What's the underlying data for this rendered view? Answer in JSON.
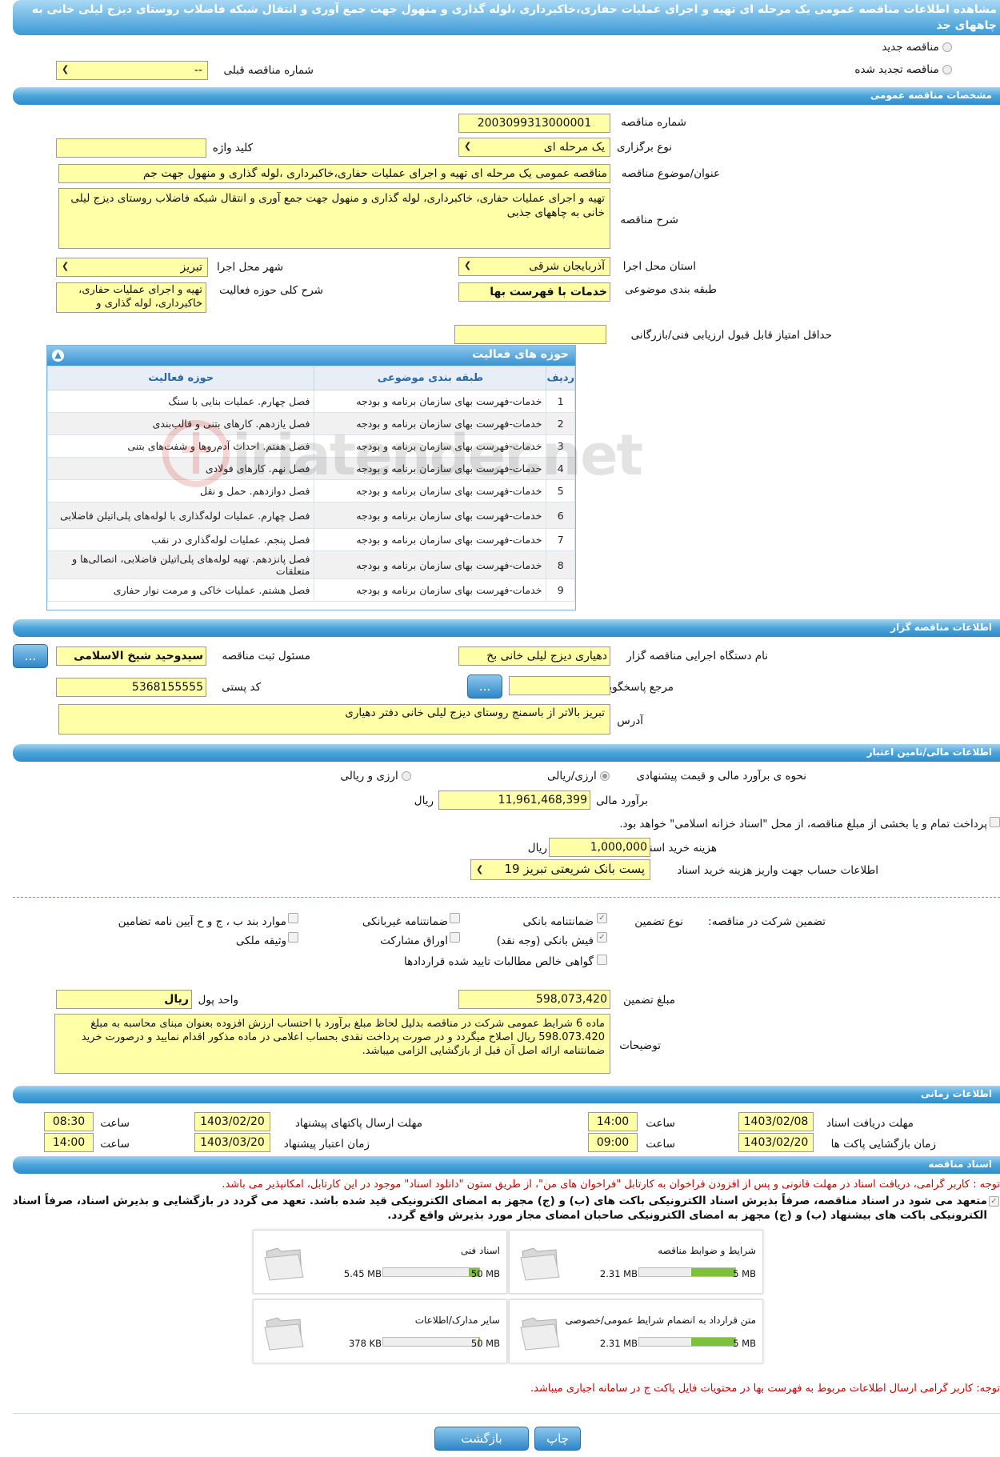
{
  "page_title": "مشاهده اطلاعات مناقصه عمومی یک مرحله ای تهیه و اجرای عملیات حفاری،خاکبرداری ،لوله گذاری و منهول جهت جمع آوری و انتقال شبکه فاضلاب روستای دیزج لیلی خانی به چاههای جذ",
  "top": {
    "new_tender": "مناقصه جدید",
    "renewed_tender": "مناقصه تجدید شده",
    "prev_tender_label": "شماره مناقصه قبلی",
    "prev_tender_value": "--"
  },
  "sections": {
    "general": "مشخصات مناقصه عمومی",
    "organizer": "اطلاعات مناقصه گزار",
    "financial": "اطلاعات مالی/تامین اعتبار",
    "timing": "اطلاعات زمانی",
    "documents": "اسناد مناقصه"
  },
  "general": {
    "tender_number_label": "شماره مناقصه",
    "tender_number": "2003099313000001",
    "holding_type_label": "نوع برگزاری",
    "holding_type": "یک مرحله ای",
    "keyword_label": "کلید واژه",
    "keyword": "",
    "subject_label": "عنوان/موضوع مناقصه",
    "subject": "مناقصه عمومی یک مرحله ای تهیه و  اجرای عملیات حفاری،خاکبرداری ،لوله گذاری و منهول جهت جم",
    "description_label": "شرح مناقصه",
    "description": "تهیه و  اجرای عملیات حفاری، خاکبرداری، لوله گذاری و منهول جهت جمع آوری و انتقال شبکه فاضلاب روستای دیزج لیلی خانی به چاههای جذبی",
    "province_label": "استان محل اجرا",
    "province": "آذربایجان شرقی",
    "city_label": "شهر محل اجرا",
    "city": "تبریز",
    "category_label": "طبقه بندی موضوعی",
    "category": "خدمات با فهرست بها",
    "activity_desc_label": "شرح کلی حوزه فعالیت",
    "activity_desc": "تهیه و  اجرای عملیات حفاری، خاکبرداری، لوله گذاری و",
    "min_score_label": "حداقل امتیاز قابل قبول ارزیابی فنی/بازرگانی",
    "min_score": ""
  },
  "activity_table": {
    "title": "حوزه های فعالیت",
    "columns": [
      "ردیف",
      "طبقه بندی موضوعی",
      "حوزه فعالیت"
    ],
    "rows": [
      [
        "1",
        "خدمات-فهرست بهای سازمان برنامه و بودجه",
        "فصل چهارم. عملیات بنایی با سنگ"
      ],
      [
        "2",
        "خدمات-فهرست بهای سازمان برنامه و بودجه",
        "فصل یازدهم. کارهای بتنی و قالب‌بندی"
      ],
      [
        "3",
        "خدمات-فهرست بهای سازمان برنامه و بودجه",
        "فصل هفتم. احداث آدم‌روها و شفت‌های بتنی"
      ],
      [
        "4",
        "خدمات-فهرست بهای سازمان برنامه و بودجه",
        "فصل نهم. کارهای فولادی"
      ],
      [
        "5",
        "خدمات-فهرست بهای سازمان برنامه و بودجه",
        "فصل دوازدهم. حمل و نقل"
      ],
      [
        "6",
        "خدمات-فهرست بهای سازمان برنامه و بودجه",
        "فصل چهارم. عملیات لوله‌گذاری با لوله‌های پلی‌اتیلن فاضلابی"
      ],
      [
        "7",
        "خدمات-فهرست بهای سازمان برنامه و بودجه",
        "فصل پنجم. عملیات لوله‌گذاری در نقب"
      ],
      [
        "8",
        "خدمات-فهرست بهای سازمان برنامه و بودجه",
        "فصل پانزدهم. تهیه لوله‌های پلی‌اتیلن فاضلابی، اتصالی‌ها و متعلقات"
      ],
      [
        "9",
        "خدمات-فهرست بهای سازمان برنامه و بودجه",
        "فصل هشتم. عملیات خاکی و مرمت نوار حفاری"
      ]
    ]
  },
  "watermark": "iriatender.net",
  "organizer": {
    "org_name_label": "نام دستگاه اجرایی مناقصه گزار",
    "org_name": "دهیاری دیزج لیلی خانی بخ",
    "registrar_label": "مسئول ثبت مناقصه",
    "registrar": "سیدوحید شیخ الاسلامی",
    "more_button": "...",
    "reference_label": "مرجع پاسخگویی",
    "reference": "",
    "postal_label": "کد پستی",
    "postal": "5368155555",
    "address_label": "آدرس",
    "address": "تبریز بالاتر از باسمنج روستای دیزج لیلی خانی دفتر دهیاری"
  },
  "financial": {
    "estimate_type_label": "نحوه ی برآورد مالی و قیمت پیشنهادی",
    "opt_rial": "ارزی/ریالی",
    "opt_fx": "ارزی و ریالی",
    "estimate_label": "برآورد مالی",
    "estimate": "11,961,468,399",
    "rial": "ریال",
    "treasury_note": "پرداخت تمام و یا بخشی از مبلغ مناقصه، از محل \"اسناد خزانه اسلامی\" خواهد بود.",
    "doc_fee_label": "هزینه خرید اسناد",
    "doc_fee": "1,000,000",
    "account_label": "اطلاعات حساب جهت واریز هزینه خرید اسناد",
    "account": "پست بانک شریعتی تبریز 19",
    "guarantee_label": "تضمین شرکت در مناقصه:",
    "guarantee_type_label": "نوع تضمین",
    "g_bank": "ضمانتنامه بانکی",
    "g_nonbank": "ضمانتنامه غیربانکی",
    "g_clauses": "موارد بند ب ، ج و ح آیین نامه تضامین",
    "g_check": "فیش بانکی (وجه نقد)",
    "g_bonds": "اوراق مشارکت",
    "g_property": "وثیقه ملکی",
    "g_receivable": "گواهی خالص مطالبات تایید شده قراردادها",
    "amount_label": "مبلغ تضمین",
    "amount": "598,073,420",
    "currency_label": "واحد پول",
    "currency": "ریال",
    "notes_label": "توضیحات",
    "notes": "ماده 6 شرایط عمومی شرکت در مناقصه بدلیل لحاظ مبلغ برآورد با احتساب ارزش افزوده بعنوان مبنای محاسبه به مبلغ 598.073.420 ریال اصلاح میگردد و در صورت پرداخت نقدی بحساب اعلامی در ماده مذکور اقدام نمایید و درصورت خرید ضمانتنامه ارائه اصل آن قبل از بازگشایی الزامی میباشد."
  },
  "timing": {
    "receive_deadline_label": "مهلت دریافت اسناد",
    "receive_deadline": "1403/02/08",
    "time_label": "ساعت",
    "receive_time": "14:00",
    "send_deadline_label": "مهلت ارسال پاکتهای پیشنهاد",
    "send_deadline": "1403/02/20",
    "send_time": "08:30",
    "opening_label": "زمان بازگشایی پاکت ها",
    "opening": "1403/02/20",
    "opening_time": "09:00",
    "validity_label": "زمان اعتبار پیشنهاد",
    "validity": "1403/03/20",
    "validity_time": "14:00"
  },
  "documents": {
    "note1": "توجه : کاربر گرامی، دریافت اسناد در مهلت قانونی و پس از افزودن فراخوان به کارتابل \"فراخوان های من\"، از طریق ستون \"دانلود اسناد\" موجود در این کارتابل، امکانپذیر می باشد.",
    "commitment": "متعهد می شود در اسناد مناقصه، صرفاً بذیرش اسناد الکترونیکی باکت های (ب) و (ج) مجهز به امضای الکترونیکی قید شده باشد. تعهد می گردد در بازگشایی و بذیرش اسناد، صرفاً اسناد الکترونیکی باکت های بیشنهاد (ب) و (ج) مجهز به امضای الکترونیکی صاحبان امضای مجاز مورد بذیرش واقع گردد.",
    "files": [
      {
        "title": "شرایط و ضوابط مناقصه",
        "size": "2.31 MB",
        "max": "5 MB",
        "ratio": 0.46
      },
      {
        "title": "اسناد فنی",
        "size": "5.45 MB",
        "max": "50 MB",
        "ratio": 0.109
      },
      {
        "title": "متن قرارداد به انضمام شرایط عمومی/خصوصی",
        "size": "2.31 MB",
        "max": "5 MB",
        "ratio": 0.46
      },
      {
        "title": "سایر مدارک/اطلاعات",
        "size": "378 KB",
        "max": "50 MB",
        "ratio": 0.008
      }
    ],
    "note2": "توجه: کاربر گرامی ارسال اطلاعات مربوط به فهرست بها در محتویات فایل پاکت ج در سامانه اجباری میباشد."
  },
  "buttons": {
    "back": "بازگشت",
    "print": "چاپ"
  },
  "colors": {
    "field_bg": "#ffffa8",
    "header_bar": "#2f8ccc",
    "note_red": "#cc0000",
    "progress": "#7ec13a"
  }
}
